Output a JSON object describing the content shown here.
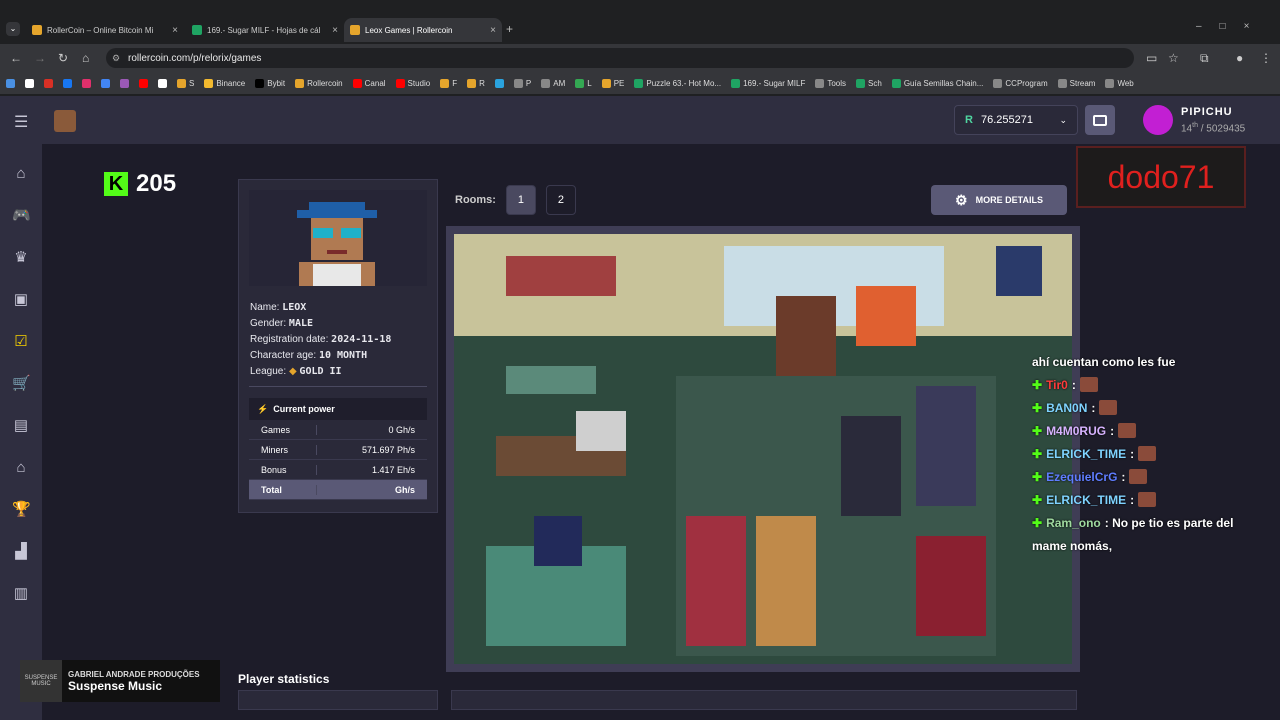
{
  "browser": {
    "tabs": [
      {
        "label": "RollerCoin – Online Bitcoin Mi",
        "active": false,
        "color": "#e5a52c"
      },
      {
        "label": "169.- Sugar MILF - Hojas de cál",
        "active": false,
        "color": "#1fa463"
      },
      {
        "label": "Leox Games | Rollercoin",
        "active": true,
        "color": "#e5a52c"
      }
    ],
    "url": "rollercoin.com/p/relorix/games",
    "bookmarks": [
      {
        "label": "",
        "color": "#4a90e2"
      },
      {
        "label": "",
        "color": "#ffffff"
      },
      {
        "label": "",
        "color": "#d93025"
      },
      {
        "label": "",
        "color": "#1877f2"
      },
      {
        "label": "",
        "color": "#e1306c"
      },
      {
        "label": "",
        "color": "#4285f4"
      },
      {
        "label": "",
        "color": "#9b59b6"
      },
      {
        "label": "",
        "color": "#ff0000"
      },
      {
        "label": "",
        "color": "#ffffff"
      },
      {
        "label": "S",
        "color": "#e5a52c"
      },
      {
        "label": "Binance",
        "color": "#f3ba2f"
      },
      {
        "label": "Bybit",
        "color": "#000000"
      },
      {
        "label": "Rollercoin",
        "color": "#e5a52c"
      },
      {
        "label": "Canal",
        "color": "#ff0000"
      },
      {
        "label": "Studio",
        "color": "#ff0000"
      },
      {
        "label": "F",
        "color": "#e5a52c"
      },
      {
        "label": "R",
        "color": "#e5a52c"
      },
      {
        "label": "",
        "color": "#2aa3de"
      },
      {
        "label": "P",
        "color": "#888888"
      },
      {
        "label": "AM",
        "color": "#888888"
      },
      {
        "label": "L",
        "color": "#34a853"
      },
      {
        "label": "PE",
        "color": "#e5a52c"
      },
      {
        "label": "Puzzle 63.- Hot Mo...",
        "color": "#1fa463"
      },
      {
        "label": "169.- Sugar MILF",
        "color": "#1fa463"
      },
      {
        "label": "Tools",
        "color": "#888888"
      },
      {
        "label": "Sch",
        "color": "#1fa463"
      },
      {
        "label": "Guía Semillas Chain...",
        "color": "#1fa463"
      },
      {
        "label": "CCProgram",
        "color": "#888888"
      },
      {
        "label": "Stream",
        "color": "#888888"
      },
      {
        "label": "Web",
        "color": "#888888"
      }
    ]
  },
  "header": {
    "balance": "76.255271",
    "currency_icon": "R",
    "username": "PIPICHU",
    "rank": "14",
    "rank_suffix": "th",
    "rank_total": " / 5029435"
  },
  "overlay": {
    "kick_count": "205",
    "dodo": "dodo71"
  },
  "player": {
    "name_label": "Name: ",
    "name": "LEOX",
    "gender_label": "Gender: ",
    "gender": "MALE",
    "reg_label": "Registration date: ",
    "reg": "2024-11-18",
    "age_label": "Character age: ",
    "age": "10 MONTH",
    "league_label": "League: ",
    "league": "GOLD II",
    "power_title": "Current power",
    "power": [
      {
        "label": "Games",
        "value": "0 Gh/s"
      },
      {
        "label": "Miners",
        "value": "571.697 Ph/s"
      },
      {
        "label": "Bonus",
        "value": "1.417 Eh/s"
      }
    ],
    "total_label": "Total",
    "total_value": "Gh/s"
  },
  "rooms": {
    "label": "Rooms:",
    "items": [
      "1",
      "2"
    ],
    "active": "1",
    "details": "MORE DETAILS"
  },
  "stats_title": "Player statistics",
  "chat": [
    {
      "user": "",
      "text": "ahí cuentan como les fue",
      "color": "#ffffff"
    },
    {
      "user": "Tir0",
      "text": ":",
      "color": "#ff3b3b"
    },
    {
      "user": "BAN0N",
      "text": ":",
      "color": "#7fd3ff"
    },
    {
      "user": "M4M0RUG",
      "text": ":",
      "color": "#d7b3ff"
    },
    {
      "user": "ELRICK_TIME",
      "text": ":",
      "color": "#7fd3ff"
    },
    {
      "user": "EzequielCrG",
      "text": ":",
      "color": "#5f7dff"
    },
    {
      "user": "ELRICK_TIME",
      "text": ":",
      "color": "#7fd3ff"
    },
    {
      "user": "Ram_ono",
      "text": ": No pe tio  es parte del",
      "color": "#9fd99f"
    },
    {
      "user": "",
      "text": "mame nomás,",
      "color": "#ffffff"
    }
  ],
  "music": {
    "cover": "SUSPENSE MUSIC",
    "artist": "GABRIEL ANDRADE PRODUÇÕES",
    "title": "Suspense Music"
  }
}
